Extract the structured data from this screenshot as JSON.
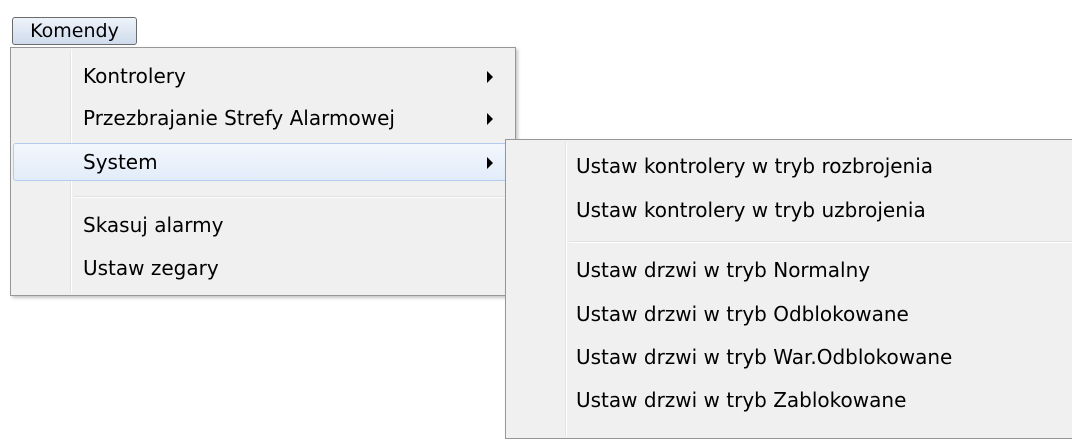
{
  "menubar": {
    "commands_label": "Komendy"
  },
  "commands_menu": {
    "items": [
      {
        "label": "Kontrolery",
        "has_submenu": true
      },
      {
        "label": "Przezbrajanie Strefy Alarmowej",
        "has_submenu": true
      },
      {
        "label": "System",
        "has_submenu": true,
        "highlighted": true
      },
      {
        "label": "Skasuj alarmy"
      },
      {
        "label": "Ustaw zegary"
      }
    ]
  },
  "system_submenu": {
    "items": [
      {
        "label": "Ustaw kontrolery w tryb rozbrojenia"
      },
      {
        "label": "Ustaw kontrolery w tryb uzbrojenia"
      },
      {
        "label": "Ustaw drzwi w tryb Normalny"
      },
      {
        "label": "Ustaw drzwi w tryb Odblokowane"
      },
      {
        "label": "Ustaw drzwi w tryb War.Odblokowane"
      },
      {
        "label": "Ustaw drzwi w tryb Zablokowane"
      }
    ]
  }
}
